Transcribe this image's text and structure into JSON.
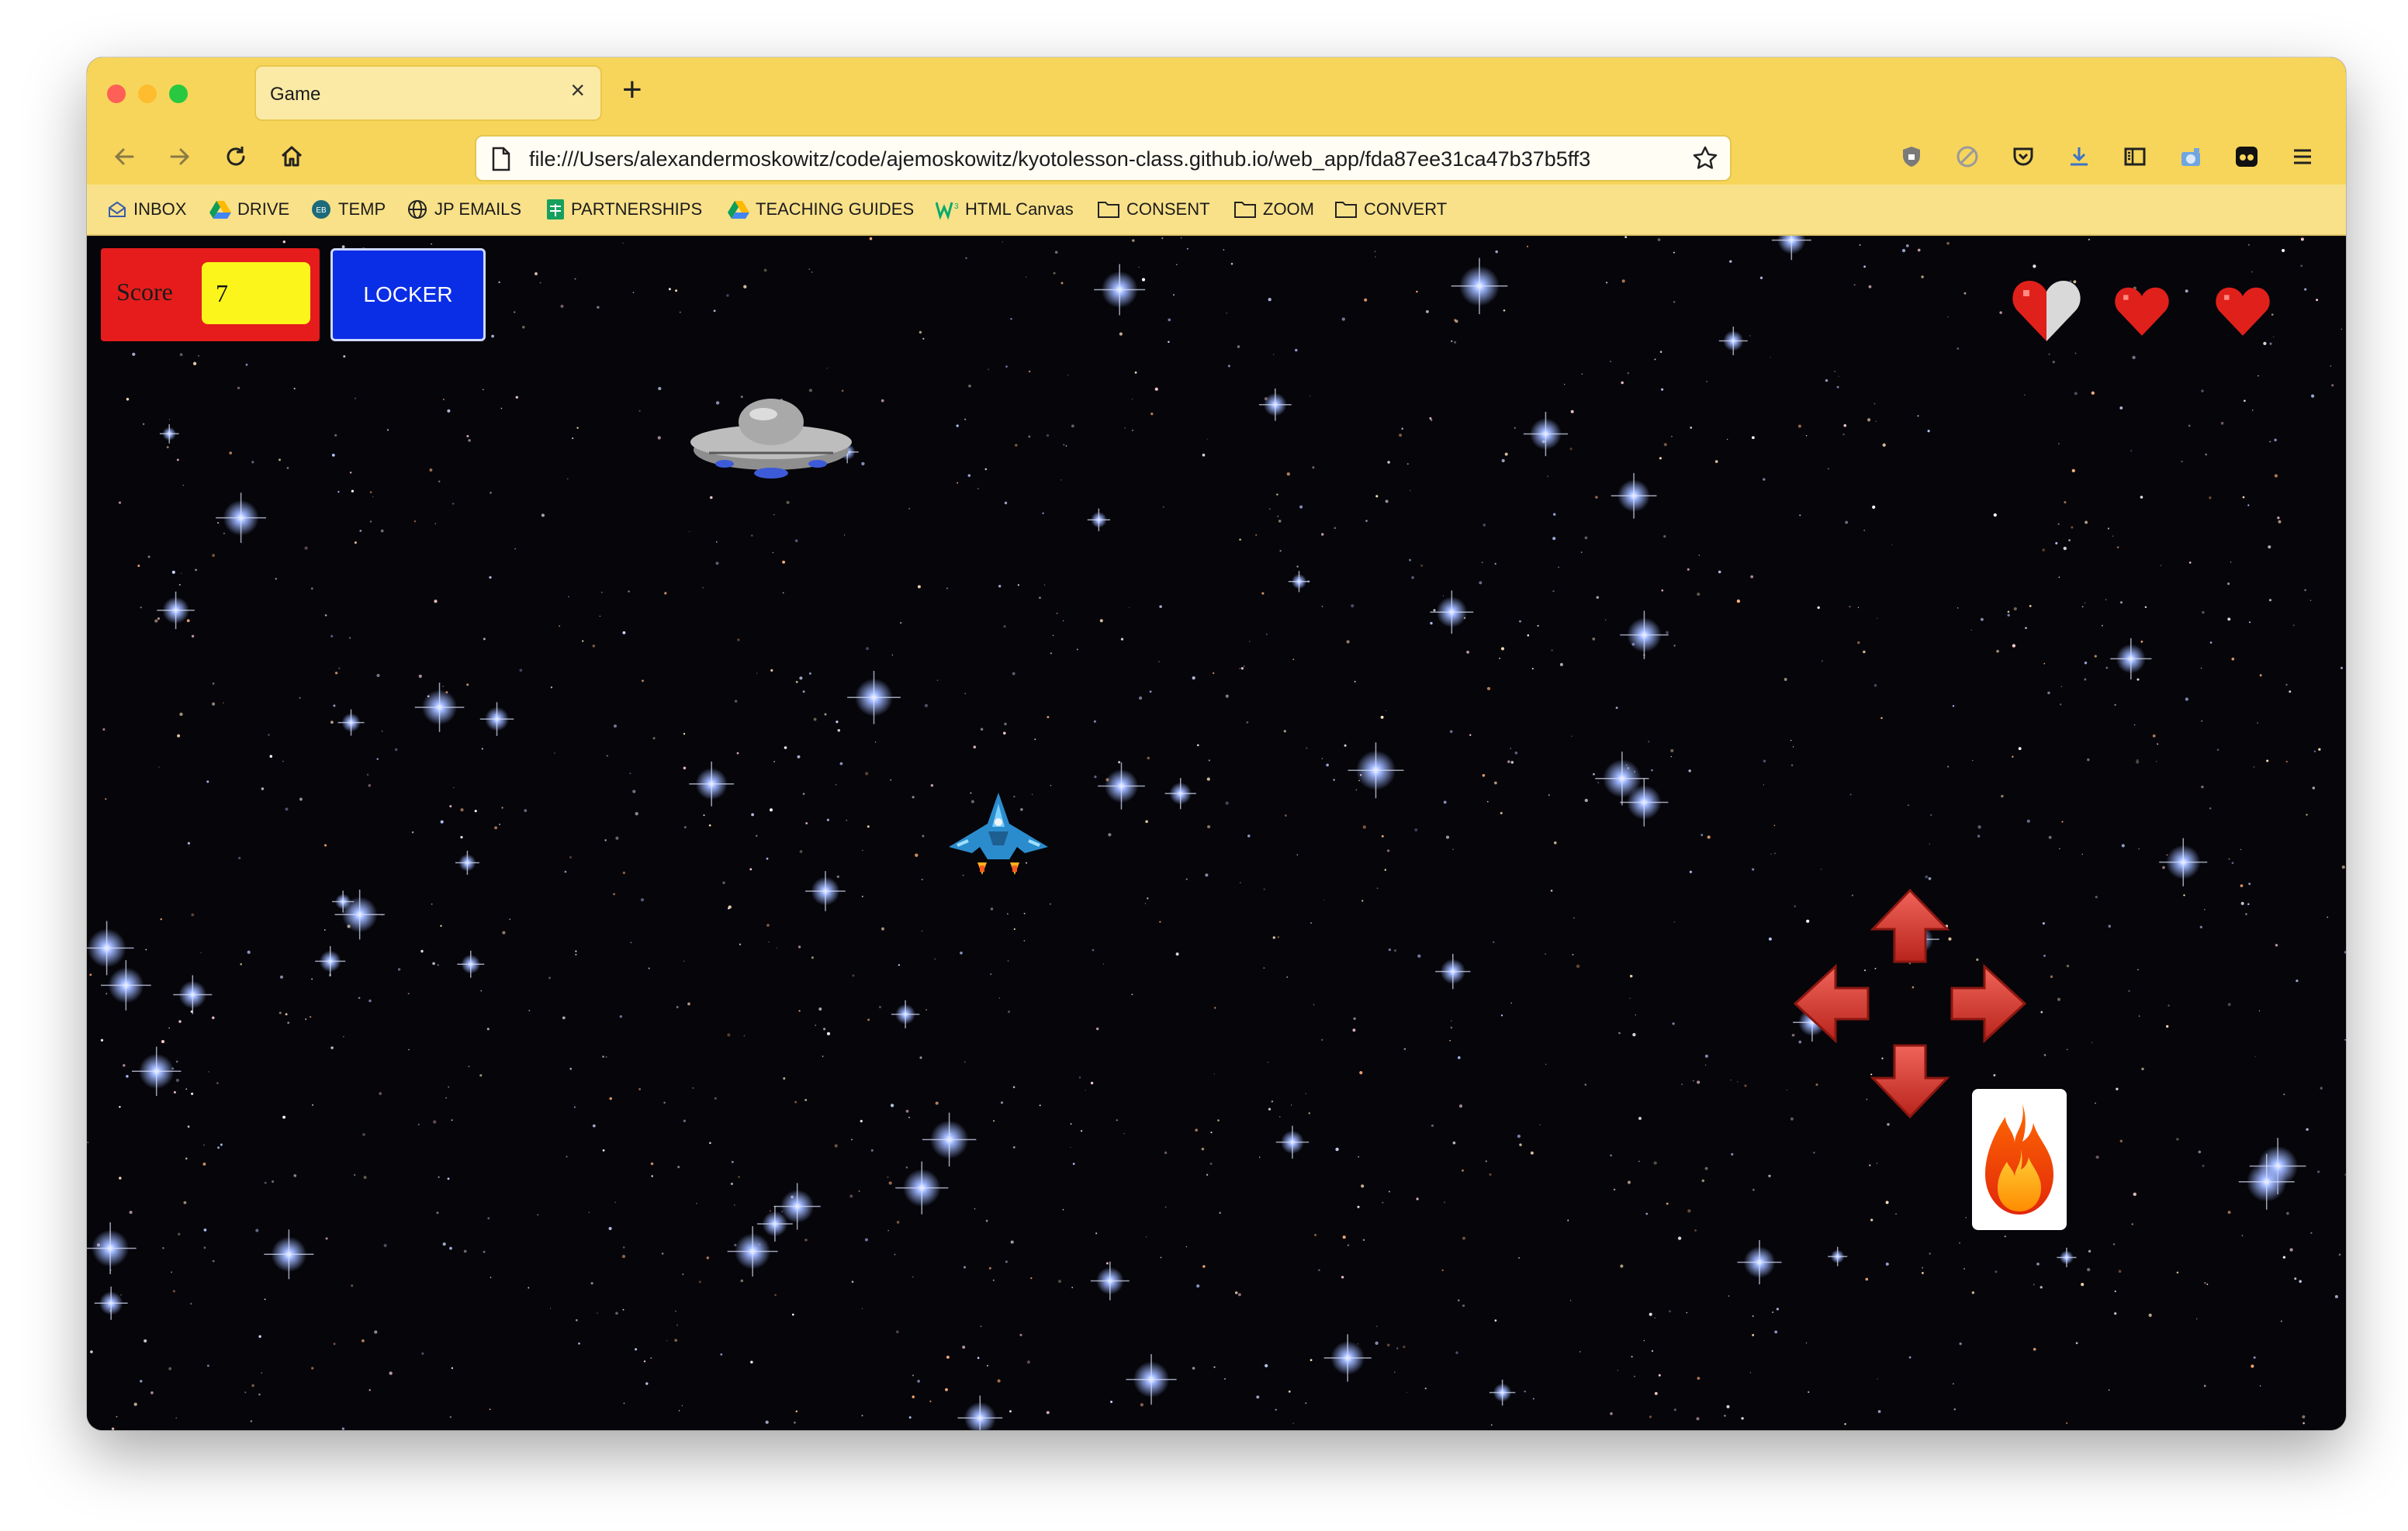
{
  "browser": {
    "tab_title": "Game",
    "tab_close": "×",
    "new_tab": "+",
    "url": "file:///Users/alexandermoskowitz/code/ajemoskowitz/kyotolesson-class.github.io/web_app/fda87ee31ca47b37b5ff3"
  },
  "bookmarks": [
    {
      "label": "INBOX",
      "icon": "mail-icon"
    },
    {
      "label": "DRIVE",
      "icon": "drive-icon"
    },
    {
      "label": "TEMP",
      "icon": "globe-badge-icon"
    },
    {
      "label": "JP EMAILS",
      "icon": "globe-icon"
    },
    {
      "label": "PARTNERSHIPS",
      "icon": "sheets-icon"
    },
    {
      "label": "TEACHING GUIDES",
      "icon": "drive-icon"
    },
    {
      "label": "HTML Canvas",
      "icon": "w3-icon"
    },
    {
      "label": "CONSENT",
      "icon": "folder-icon"
    },
    {
      "label": "ZOOM",
      "icon": "folder-icon"
    },
    {
      "label": "CONVERT",
      "icon": "folder-icon"
    }
  ],
  "game": {
    "score_label": "Score",
    "score_value": "7",
    "locker_label": "LOCKER",
    "lives": [
      0.5,
      1,
      1
    ]
  },
  "colors": {
    "chrome": "#f7d55a",
    "score_bg": "#e61c1c",
    "score_field": "#fbf51c",
    "locker_bg": "#0a2ee6",
    "heart": "#e0201a",
    "arrow": "#d93a2e"
  }
}
